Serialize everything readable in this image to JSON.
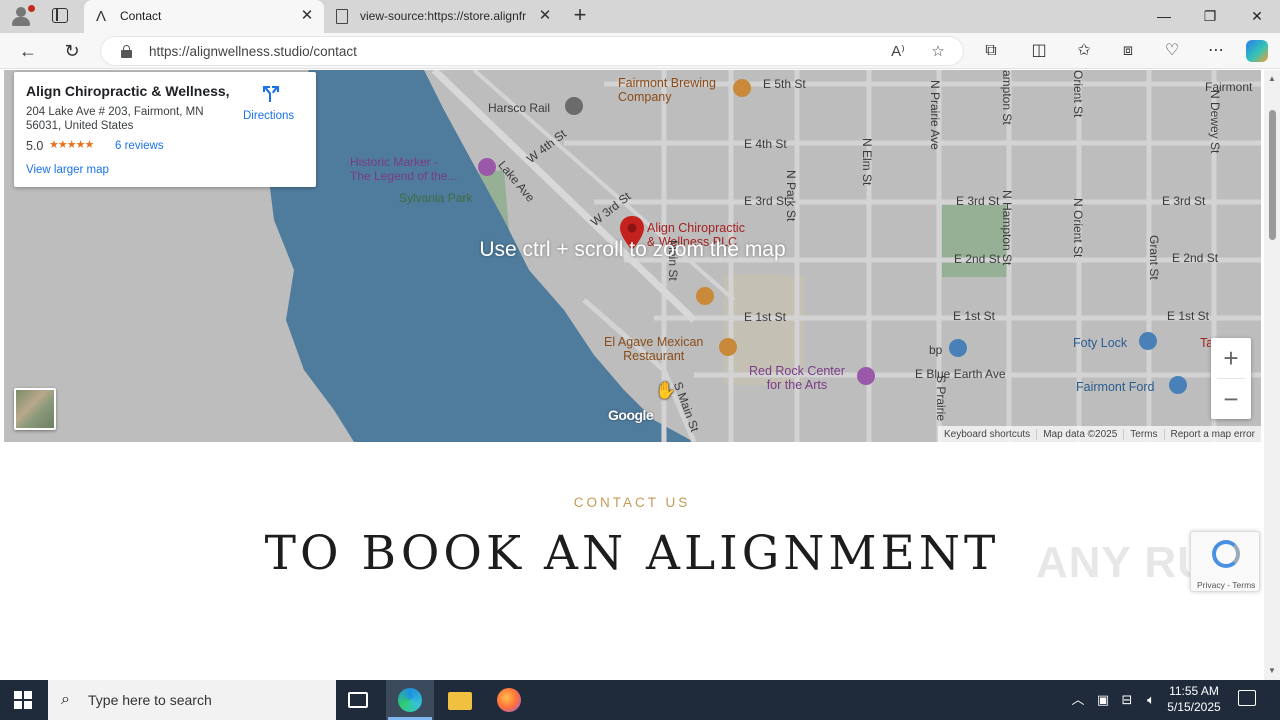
{
  "browser": {
    "tabs": [
      {
        "title": "Contact",
        "active": true
      },
      {
        "title": "view-source:https://store.alignfr",
        "active": false
      }
    ],
    "url": "https://alignwellness.studio/contact"
  },
  "map": {
    "card": {
      "name": "Align Chiropractic & Wellness,...",
      "address": "204 Lake Ave # 203, Fairmont, MN 56031, United States",
      "rating": "5.0",
      "stars": "★★★★★",
      "reviews": "6 reviews",
      "directions": "Directions",
      "larger_map": "View larger map"
    },
    "zoom_hint": "Use ctrl + scroll to zoom the map",
    "labels": {
      "fairmont_brewing": "Fairmont Brewing\nCompany",
      "harsco": "Harsco Rail",
      "historic_marker": "Historic Marker -\nThe Legend of the...",
      "sylvania": "Sylvania Park",
      "align_pin": "Align Chiropractic\n& Wellness PLC",
      "el_agave": "El Agave Mexican\nRestaurant",
      "red_rock": "Red Rock Center\nfor the Arts",
      "foty_lock": "Foty Lock",
      "fairmont_ford": "Fairmont Ford",
      "fairmont": "Fairmont",
      "bp": "bp",
      "e5th": "E 5th St",
      "e4th": "E 4th St",
      "w4th": "W 4th St",
      "e3rd": "E 3rd St",
      "w3rd": "W 3rd St",
      "e3rd_b": "E 3rd St",
      "e3rd_c": "E 3rd St",
      "e2nd": "E 2nd St",
      "e2nd_b": "E 2nd St",
      "e1st": "E 1st St",
      "e1st_b": "E 1st St",
      "e1st_c": "E 1st St",
      "blue_earth": "E Blue Earth Ave",
      "lake_ave": "Lake Ave",
      "n_park": "N Park St",
      "n_elm": "N Elm St",
      "n_prairie": "N Prairie Ave",
      "n_hampton": "N Hampton St",
      "n_orient": "N Orient St",
      "grant": "Grant St",
      "n_dewey": "N Dewey St",
      "s_main": "S Main St",
      "main_st": "Main St",
      "s_prairie": "S Prairie",
      "hampton": "ampton St",
      "orient": "Orient St",
      "ta": "Ta"
    },
    "google": "Google",
    "attribution": [
      "Keyboard shortcuts",
      "Map data ©2025",
      "Terms",
      "Report a map error"
    ],
    "zoom_in": "+",
    "zoom_out": "−"
  },
  "contact": {
    "eyebrow": "CONTACT US",
    "title": "TO BOOK AN ALIGNMENT"
  },
  "recaptcha": {
    "links": "Privacy - Terms"
  },
  "watermark": "ANY RUN",
  "taskbar": {
    "search_placeholder": "Type here to search",
    "time": "11:55 AM",
    "date": "5/15/2025"
  },
  "colors": {
    "accent_gold": "#c49a56",
    "link_blue": "#1a73e8",
    "pin_red": "#c5221f",
    "water": "#5a87a8"
  }
}
